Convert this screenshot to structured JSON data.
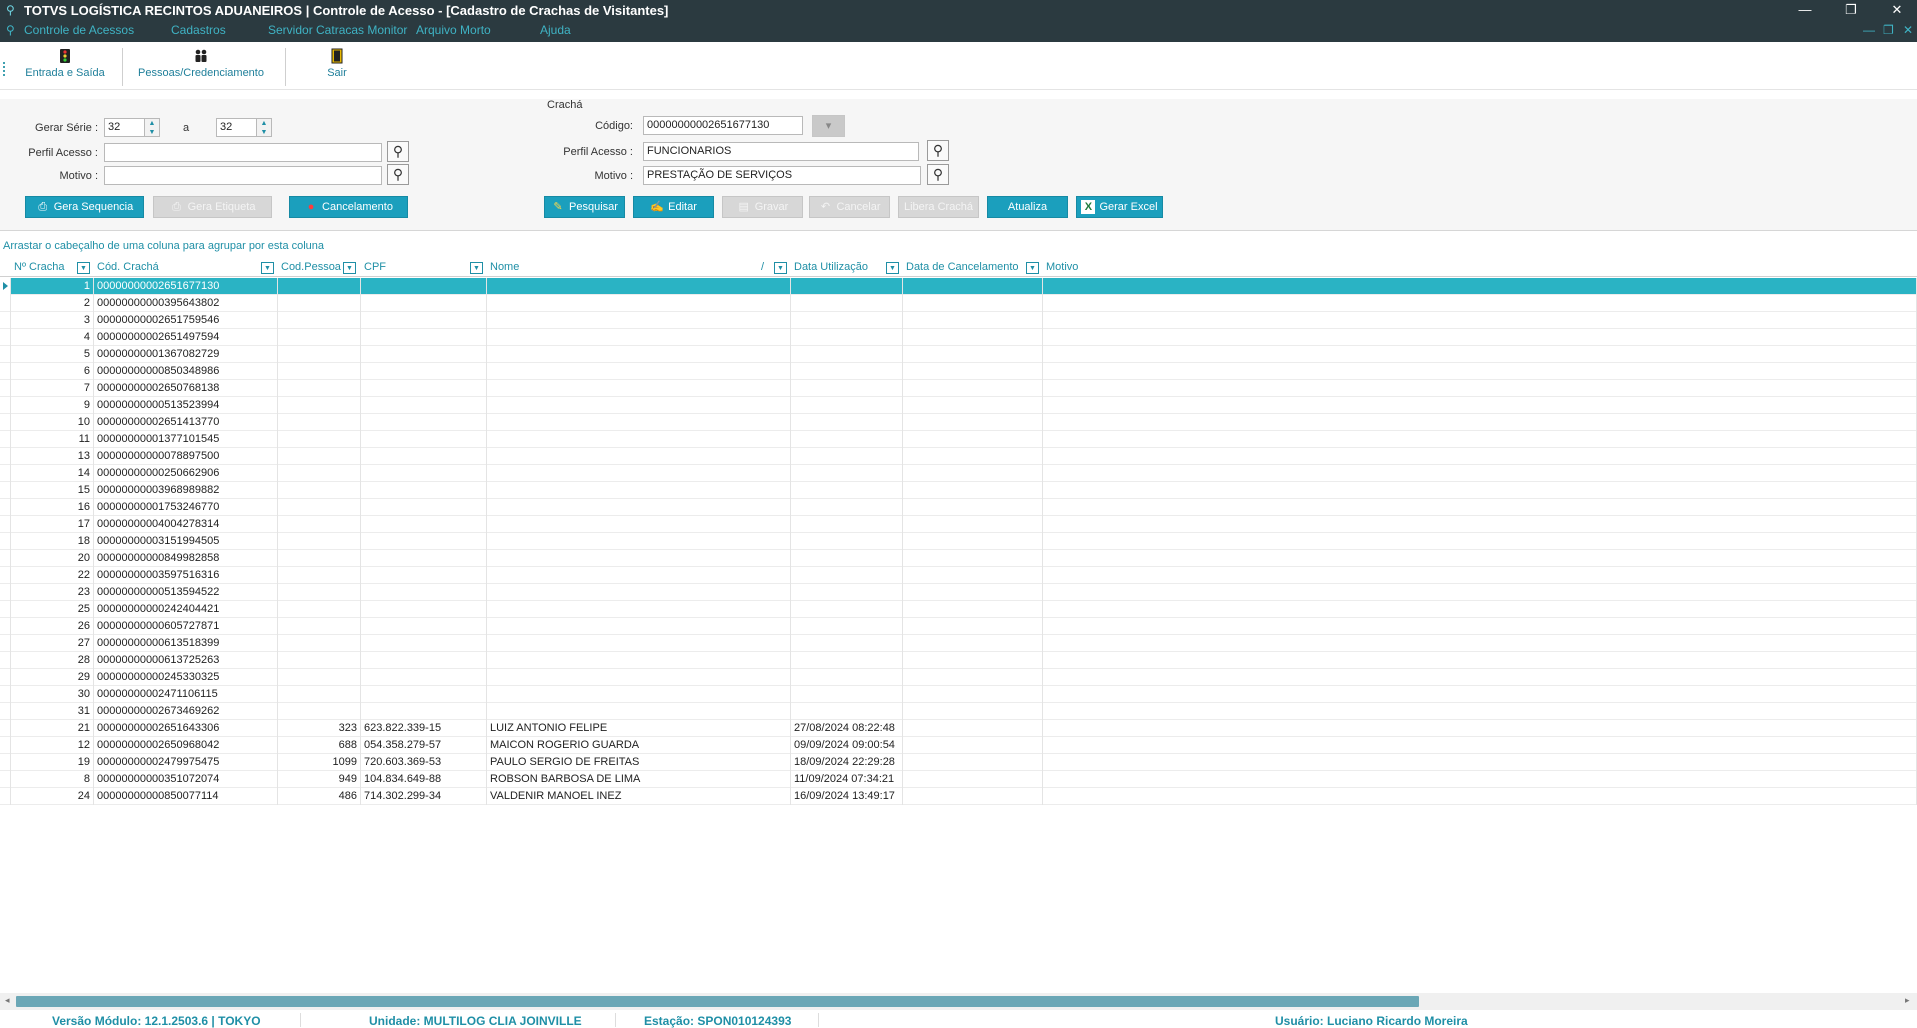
{
  "window": {
    "title": "TOTVS LOGÍSTICA RECINTOS ADUANEIROS | Controle de Acesso - [Cadastro de Crachas de Visitantes]",
    "minimize": "—",
    "restore": "❐",
    "close": "✕"
  },
  "menu": {
    "items": [
      "Controle de Acessos",
      "Cadastros",
      "Servidor Catracas Monitor",
      "Arquivo Morto",
      "Ajuda"
    ],
    "child_minimize": "—",
    "child_restore": "❐",
    "child_close": "✕"
  },
  "toolbar": {
    "entrada_saida": "Entrada e Saída",
    "pessoas": "Pessoas/Credenciamento",
    "sair": "Sair"
  },
  "left_form": {
    "gerar_serie_label": "Gerar Série :",
    "serie_from": "32",
    "serie_to_label": "a",
    "serie_to": "32",
    "perfil_label": "Perfil Acesso :",
    "perfil_value": "",
    "motivo_label": "Motivo :",
    "motivo_value": "",
    "btn_gera_sequencia": "Gera Sequencia",
    "btn_gera_etiqueta": "Gera Etiqueta",
    "btn_cancelamento": "Cancelamento"
  },
  "cracha_form": {
    "group_label": "Crachá",
    "codigo_label": "Código:",
    "codigo_value": "00000000002651677130",
    "perfil_label": "Perfil Acesso :",
    "perfil_value": "FUNCIONARIOS",
    "motivo_label": "Motivo :",
    "motivo_value": "PRESTAÇÃO DE SERVIÇOS",
    "btn_pesquisar": "Pesquisar",
    "btn_editar": "Editar",
    "btn_gravar": "Gravar",
    "btn_cancelar": "Cancelar",
    "btn_libera": "Libera Crachá",
    "btn_atualiza": "Atualiza",
    "btn_excel": "Gerar Excel"
  },
  "grid": {
    "group_hint": "Arrastar o cabeçalho de uma coluna para agrupar por esta coluna",
    "columns": [
      "Nº Cracha",
      "Cód. Crachá",
      "Cod.Pessoa",
      "CPF",
      "Nome",
      "Data Utilização",
      "Data de Cancelamento",
      "Motivo"
    ],
    "sort_marker": "/",
    "rows": [
      [
        "1",
        "00000000002651677130",
        "",
        "",
        "",
        "",
        "",
        ""
      ],
      [
        "2",
        "00000000000395643802",
        "",
        "",
        "",
        "",
        "",
        ""
      ],
      [
        "3",
        "00000000002651759546",
        "",
        "",
        "",
        "",
        "",
        ""
      ],
      [
        "4",
        "00000000002651497594",
        "",
        "",
        "",
        "",
        "",
        ""
      ],
      [
        "5",
        "00000000001367082729",
        "",
        "",
        "",
        "",
        "",
        ""
      ],
      [
        "6",
        "00000000000850348986",
        "",
        "",
        "",
        "",
        "",
        ""
      ],
      [
        "7",
        "00000000002650768138",
        "",
        "",
        "",
        "",
        "",
        ""
      ],
      [
        "9",
        "00000000000513523994",
        "",
        "",
        "",
        "",
        "",
        ""
      ],
      [
        "10",
        "00000000002651413770",
        "",
        "",
        "",
        "",
        "",
        ""
      ],
      [
        "11",
        "00000000001377101545",
        "",
        "",
        "",
        "",
        "",
        ""
      ],
      [
        "13",
        "00000000000078897500",
        "",
        "",
        "",
        "",
        "",
        ""
      ],
      [
        "14",
        "00000000000250662906",
        "",
        "",
        "",
        "",
        "",
        ""
      ],
      [
        "15",
        "00000000003968989882",
        "",
        "",
        "",
        "",
        "",
        ""
      ],
      [
        "16",
        "00000000001753246770",
        "",
        "",
        "",
        "",
        "",
        ""
      ],
      [
        "17",
        "00000000004004278314",
        "",
        "",
        "",
        "",
        "",
        ""
      ],
      [
        "18",
        "00000000003151994505",
        "",
        "",
        "",
        "",
        "",
        ""
      ],
      [
        "20",
        "00000000000849982858",
        "",
        "",
        "",
        "",
        "",
        ""
      ],
      [
        "22",
        "00000000003597516316",
        "",
        "",
        "",
        "",
        "",
        ""
      ],
      [
        "23",
        "00000000000513594522",
        "",
        "",
        "",
        "",
        "",
        ""
      ],
      [
        "25",
        "00000000000242404421",
        "",
        "",
        "",
        "",
        "",
        ""
      ],
      [
        "26",
        "00000000000605727871",
        "",
        "",
        "",
        "",
        "",
        ""
      ],
      [
        "27",
        "00000000000613518399",
        "",
        "",
        "",
        "",
        "",
        ""
      ],
      [
        "28",
        "00000000000613725263",
        "",
        "",
        "",
        "",
        "",
        ""
      ],
      [
        "29",
        "00000000000245330325",
        "",
        "",
        "",
        "",
        "",
        ""
      ],
      [
        "30",
        "00000000002471106115",
        "",
        "",
        "",
        "",
        "",
        ""
      ],
      [
        "31",
        "00000000002673469262",
        "",
        "",
        "",
        "",
        "",
        ""
      ],
      [
        "21",
        "00000000002651643306",
        "323",
        "623.822.339-15",
        "LUIZ ANTONIO FELIPE",
        "27/08/2024 08:22:48",
        "",
        ""
      ],
      [
        "12",
        "00000000002650968042",
        "688",
        "054.358.279-57",
        "MAICON ROGERIO GUARDA",
        "09/09/2024 09:00:54",
        "",
        ""
      ],
      [
        "19",
        "00000000002479975475",
        "1099",
        "720.603.369-53",
        "PAULO SERGIO DE FREITAS",
        "18/09/2024 22:29:28",
        "",
        ""
      ],
      [
        "8",
        "00000000000351072074",
        "949",
        "104.834.649-88",
        "ROBSON BARBOSA DE LIMA",
        "11/09/2024 07:34:21",
        "",
        ""
      ],
      [
        "24",
        "00000000000850077114",
        "486",
        "714.302.299-34",
        "VALDENIR MANOEL INEZ",
        "16/09/2024 13:49:17",
        "",
        ""
      ]
    ]
  },
  "status": {
    "versao": "Versão Módulo:  12.1.2503.6  |  TOKYO",
    "unidade": "Unidade: MULTILOG CLIA JOINVILLE",
    "estacao": "Estação: SPON010124393",
    "usuario": "Usuário: Luciano Ricardo Moreira"
  },
  "colors": {
    "accent": "#1b9fbd",
    "selected_row": "#2ab3c4",
    "titlebar": "#2b3a40",
    "link_text": "#1f8fa6"
  }
}
